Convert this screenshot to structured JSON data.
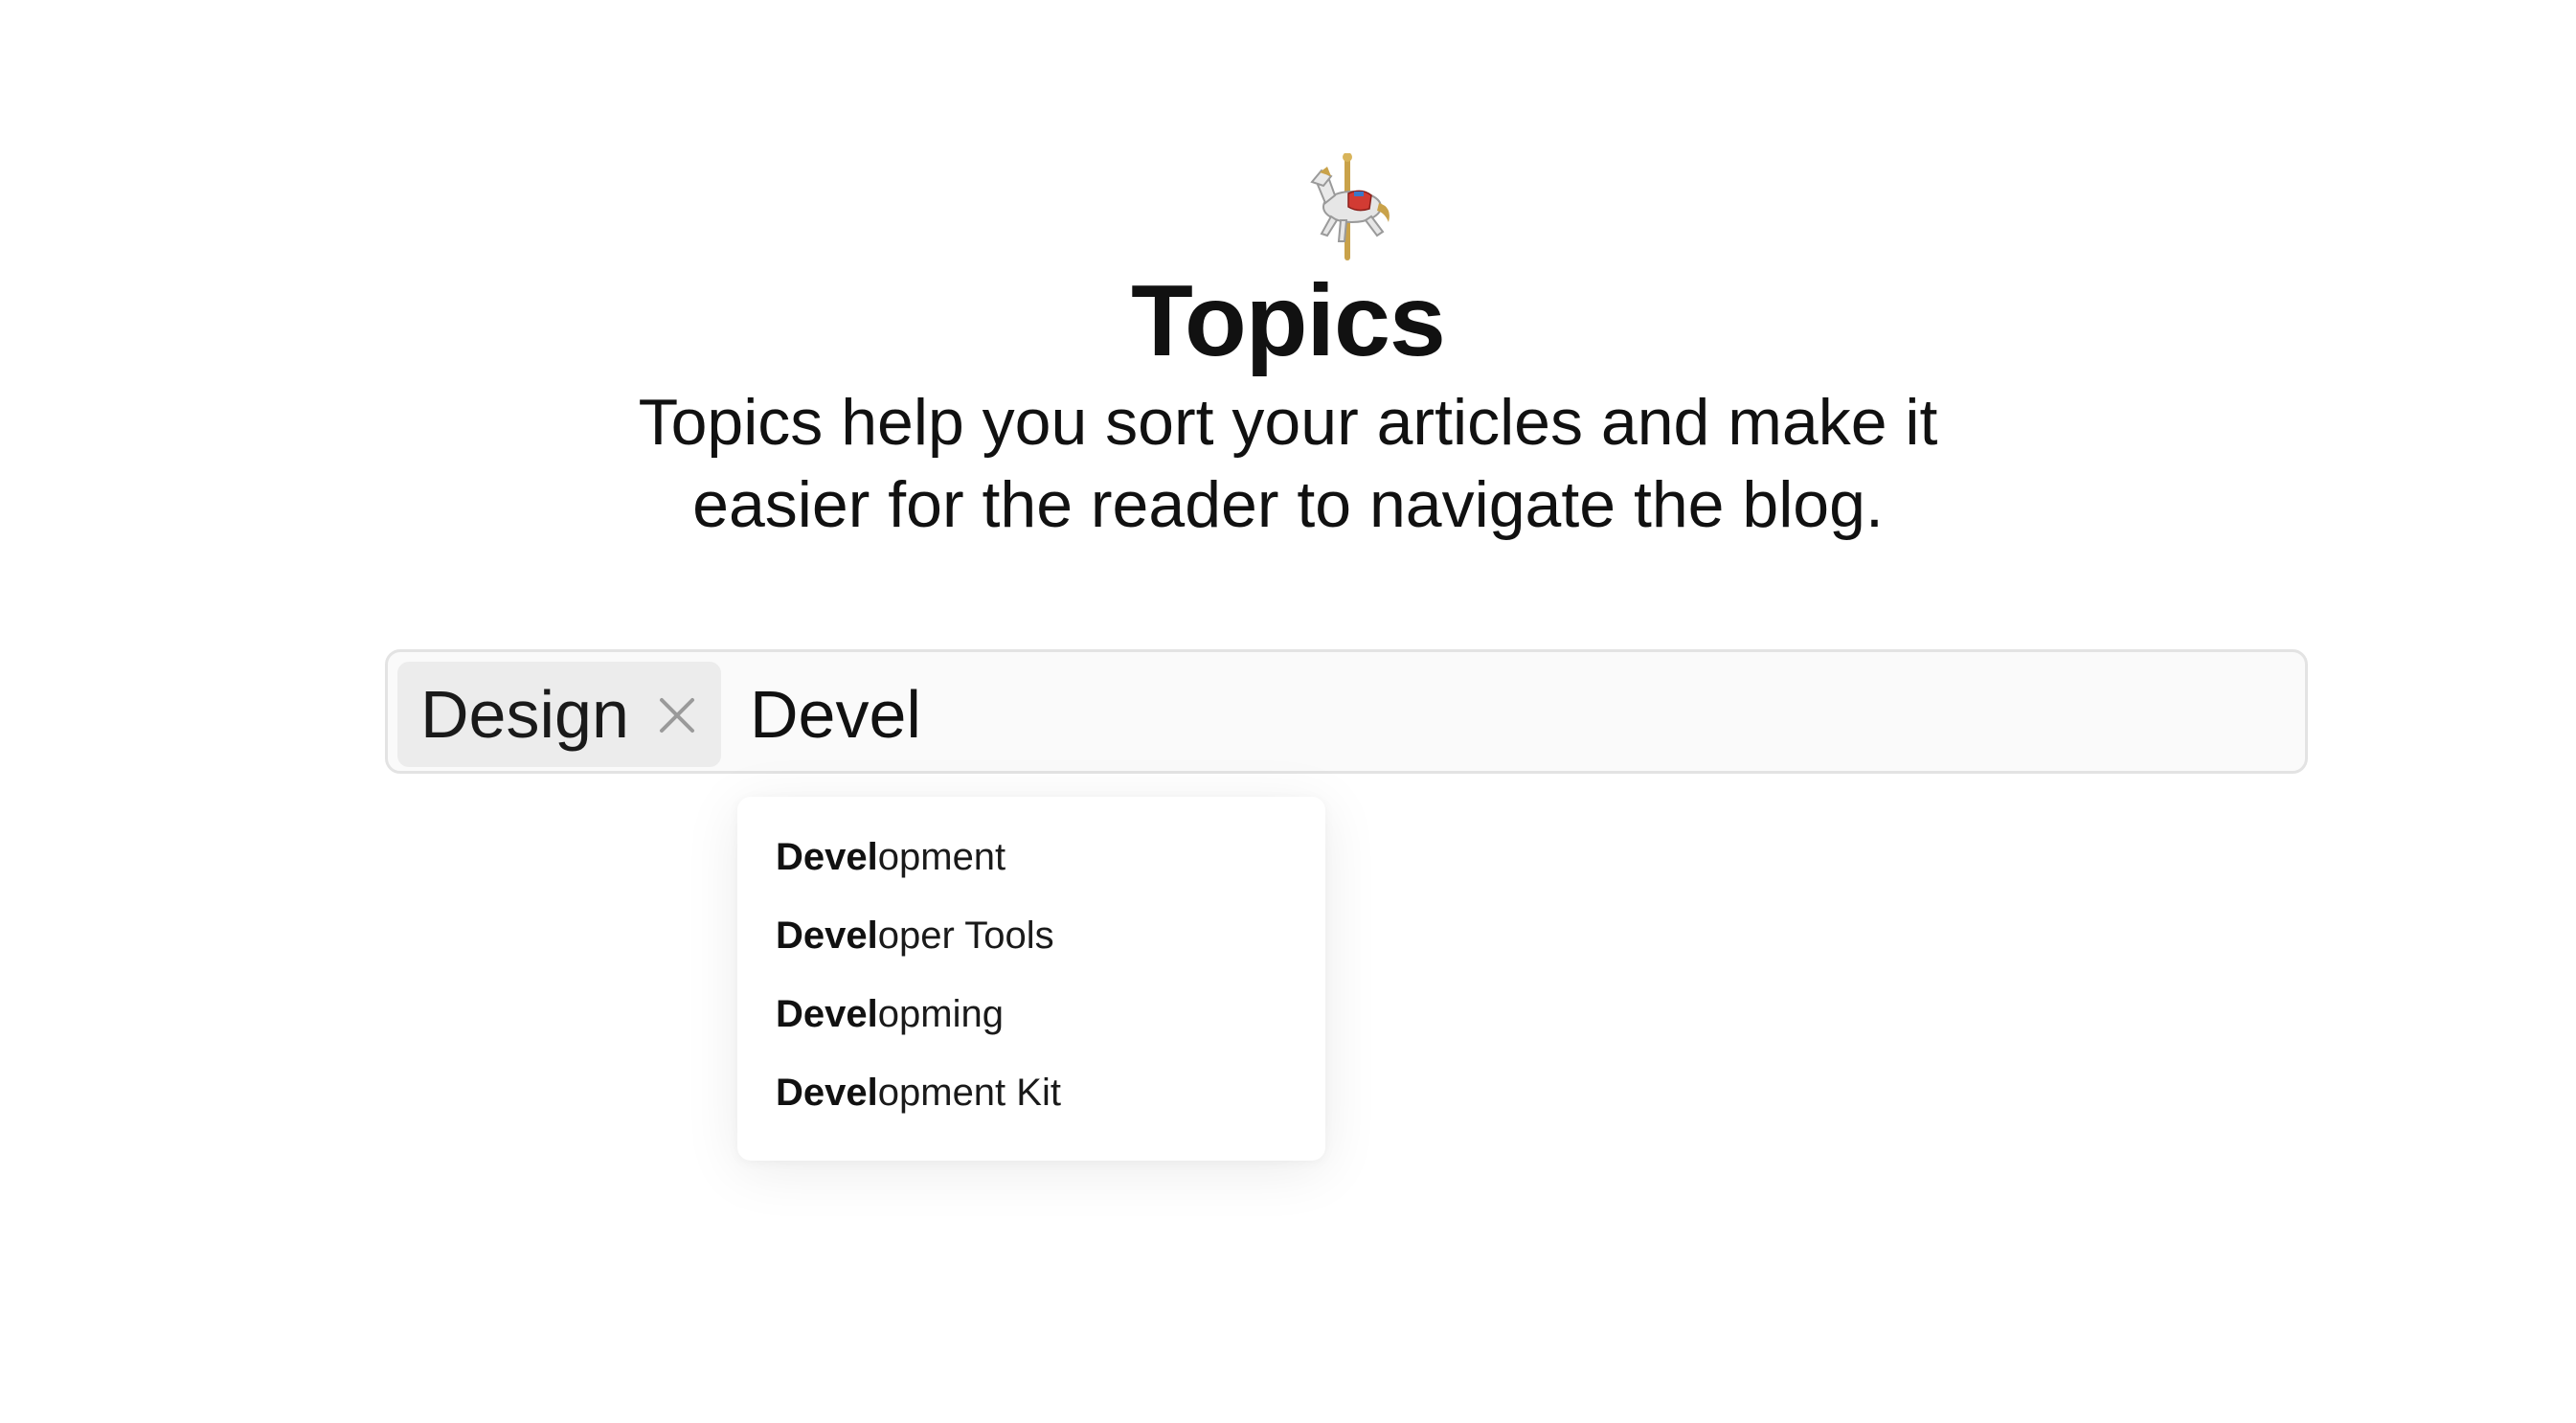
{
  "header": {
    "icon": "carousel-horse-icon",
    "title": "Topics",
    "subtitle": "Topics help you sort your articles and make it easier for the reader to navigate the blog."
  },
  "tag_input": {
    "tags": [
      {
        "label": "Design",
        "remove_icon": "close-icon"
      }
    ],
    "value": "Devel"
  },
  "suggestions": [
    {
      "match": "Devel",
      "rest": "opment"
    },
    {
      "match": "Devel",
      "rest": "oper Tools"
    },
    {
      "match": "Devel",
      "rest": "opming"
    },
    {
      "match": "Devel",
      "rest": "opment Kit"
    }
  ],
  "colors": {
    "input_border": "#e3e3e3",
    "input_background": "#fafafa",
    "chip_background": "#ececec",
    "text": "#111111"
  }
}
